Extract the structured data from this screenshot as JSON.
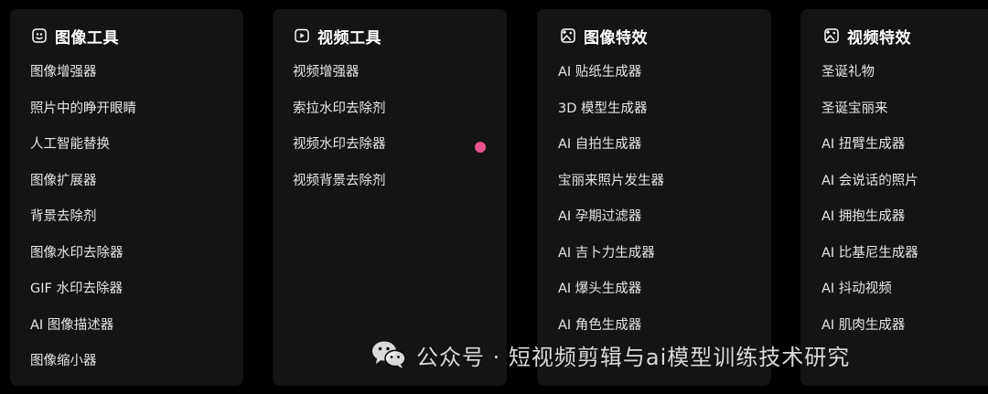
{
  "columns": [
    {
      "title": "图像工具",
      "icon": "image-tool-icon",
      "items": [
        "图像增强器",
        "照片中的睁开眼睛",
        "人工智能替换",
        "图像扩展器",
        "背景去除剂",
        "图像水印去除器",
        "GIF 水印去除器",
        "AI 图像描述器",
        "图像缩小器"
      ]
    },
    {
      "title": "视频工具",
      "icon": "video-tool-icon",
      "items": [
        "视频增强器",
        "索拉水印去除剂",
        "视频水印去除器",
        "视频背景去除剂"
      ]
    },
    {
      "title": "图像特效",
      "icon": "image-effect-icon",
      "items": [
        "AI 贴纸生成器",
        "3D 模型生成器",
        "AI 自拍生成器",
        "宝丽来照片发生器",
        "AI 孕期过滤器",
        "AI 吉卜力生成器",
        "AI 爆头生成器",
        "AI 角色生成器"
      ]
    },
    {
      "title": "视频特效",
      "icon": "video-effect-icon",
      "items": [
        "圣诞礼物",
        "圣诞宝丽来",
        "AI 扭臂生成器",
        "AI 会说话的照片",
        "AI 拥抱生成器",
        "AI 比基尼生成器",
        "AI 抖动视频",
        "AI 肌肉生成器"
      ]
    }
  ],
  "watermark": {
    "text": "公众号 · 短视频剪辑与ai模型训练技术研究",
    "icon": "wechat-icon"
  },
  "colors": {
    "page_bg": "#000000",
    "card_bg": "#141414",
    "text": "#e6e6e6",
    "title": "#ffffff",
    "dot": "#e5548e",
    "link": "#7b5cf5"
  }
}
